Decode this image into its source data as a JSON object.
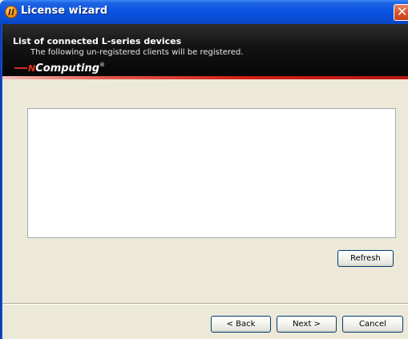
{
  "window": {
    "title": "License wizard",
    "icon": "ncomputing-app-icon",
    "close_label": "✕"
  },
  "header": {
    "heading": "List of connected L-series devices",
    "subheading": "The following un-registered clients will be registered.",
    "logo_prefix": "N",
    "logo_text": "Computing",
    "logo_reg": "®"
  },
  "device_list": {
    "items": []
  },
  "buttons": {
    "refresh": "Refresh",
    "back": "< Back",
    "next": "Next >",
    "cancel": "Cancel"
  },
  "colors": {
    "titlebar": "#0a54e3",
    "banner": "#050505",
    "accent_red": "#d21f14",
    "dialog_bg": "#ece9d8"
  }
}
